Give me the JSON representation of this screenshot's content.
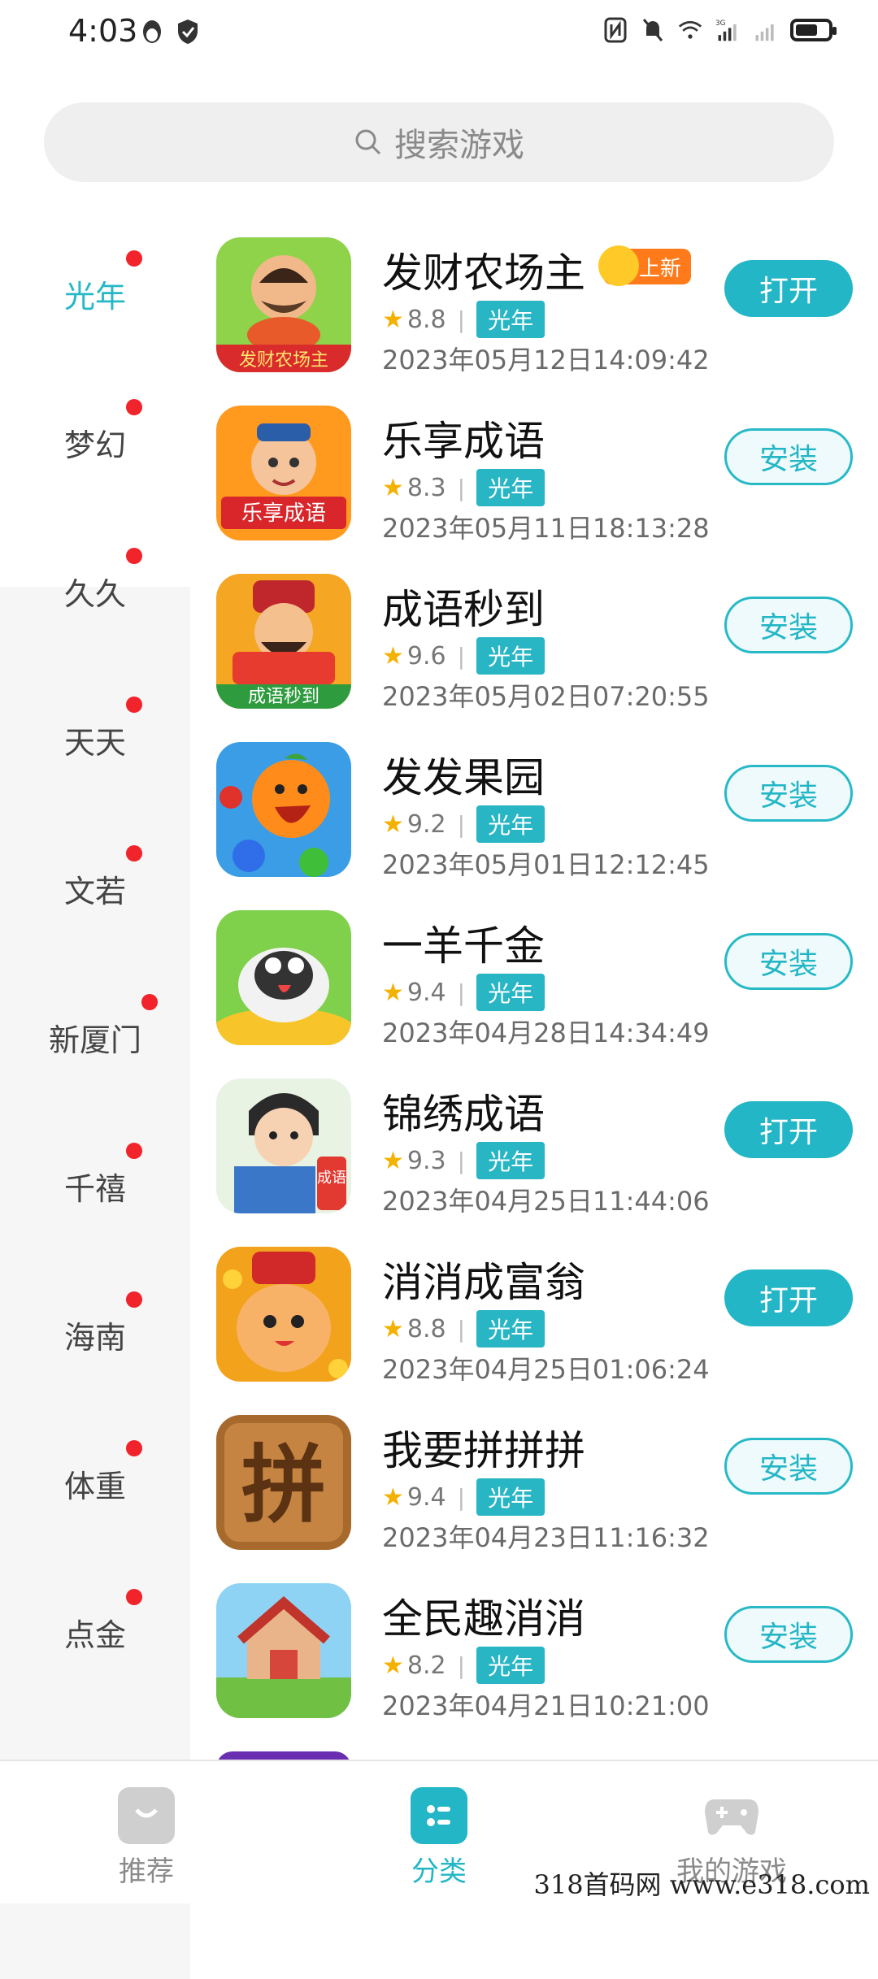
{
  "status": {
    "time": "4:03",
    "net": "3G"
  },
  "search": {
    "placeholder": "搜索游戏"
  },
  "sidebar": {
    "items": [
      {
        "label": "光年",
        "active": true,
        "dot": true
      },
      {
        "label": "梦幻",
        "dot": true
      },
      {
        "label": "久久",
        "dot": true
      },
      {
        "label": "天天",
        "dot": true
      },
      {
        "label": "文若",
        "dot": true
      },
      {
        "label": "新厦门",
        "dot": true
      },
      {
        "label": "千禧",
        "dot": true
      },
      {
        "label": "海南",
        "dot": true
      },
      {
        "label": "体重",
        "dot": true
      },
      {
        "label": "点金",
        "dot": true
      }
    ]
  },
  "games": [
    {
      "name": "发财农场主",
      "badge": "上新",
      "rating": "8.8",
      "tag": "光年",
      "date": "2023年05月12日14:09:42",
      "action": "打开",
      "icon_text": "发财农场主"
    },
    {
      "name": "乐享成语",
      "rating": "8.3",
      "tag": "光年",
      "date": "2023年05月11日18:13:28",
      "action": "安装",
      "icon_text": "乐享成语"
    },
    {
      "name": "成语秒到",
      "rating": "9.6",
      "tag": "光年",
      "date": "2023年05月02日07:20:55",
      "action": "安装",
      "icon_text": "成语秒到"
    },
    {
      "name": "发发果园",
      "rating": "9.2",
      "tag": "光年",
      "date": "2023年05月01日12:12:45",
      "action": "安装"
    },
    {
      "name": "一羊千金",
      "rating": "9.4",
      "tag": "光年",
      "date": "2023年04月28日14:34:49",
      "action": "安装"
    },
    {
      "name": "锦绣成语",
      "rating": "9.3",
      "tag": "光年",
      "date": "2023年04月25日11:44:06",
      "action": "打开",
      "icon_text": "成语"
    },
    {
      "name": "消消成富翁",
      "rating": "8.8",
      "tag": "光年",
      "date": "2023年04月25日01:06:24",
      "action": "打开"
    },
    {
      "name": "我要拼拼拼",
      "rating": "9.4",
      "tag": "光年",
      "date": "2023年04月23日11:16:32",
      "action": "安装",
      "icon_text": "拼"
    },
    {
      "name": "全民趣消消",
      "rating": "8.2",
      "tag": "光年",
      "date": "2023年04月21日10:21:00",
      "action": "安装"
    }
  ],
  "bottom_nav": [
    {
      "label": "推荐",
      "icon": "bag-icon"
    },
    {
      "label": "分类",
      "icon": "category-icon",
      "active": true
    },
    {
      "label": "我的游戏",
      "icon": "gamepad-icon"
    }
  ],
  "watermark": "318首码网 www.e318.com",
  "colors": {
    "accent": "#22b6c6",
    "red_dot": "#f1232b",
    "badge": "#ff7a1a",
    "star": "#f5b100"
  }
}
